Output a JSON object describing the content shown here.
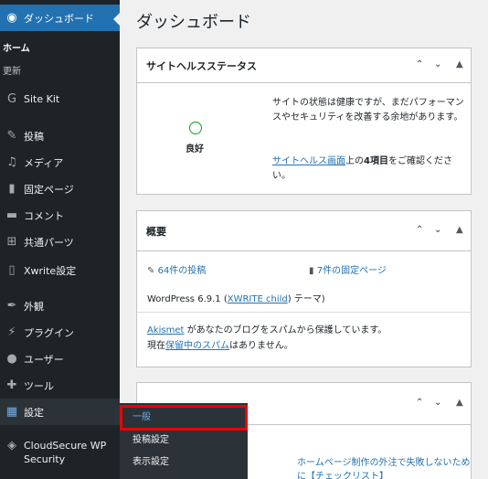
{
  "sidebar": {
    "dashboard_label": "ダッシュボード",
    "sub_home": "ホーム",
    "sub_updates": "更新",
    "items": [
      {
        "label": "Site Kit",
        "icon": "google-g-icon"
      },
      {
        "label": "投稿",
        "icon": "pin-icon"
      },
      {
        "label": "メディア",
        "icon": "media-icon"
      },
      {
        "label": "固定ページ",
        "icon": "page-icon"
      },
      {
        "label": "コメント",
        "icon": "comment-icon"
      },
      {
        "label": "共通パーツ",
        "icon": "grid-icon"
      },
      {
        "label": "Xwrite設定",
        "icon": "book-icon"
      },
      {
        "label": "外観",
        "icon": "brush-icon"
      },
      {
        "label": "プラグイン",
        "icon": "plug-icon"
      },
      {
        "label": "ユーザー",
        "icon": "user-icon"
      },
      {
        "label": "ツール",
        "icon": "wrench-icon"
      },
      {
        "label": "設定",
        "icon": "settings-icon"
      },
      {
        "label": "CloudSecure WP Security",
        "icon": "shield-icon"
      }
    ]
  },
  "flyout": {
    "items": [
      "一般",
      "投稿設定",
      "表示設定"
    ]
  },
  "main": {
    "title": "ダッシュボード",
    "site_health": {
      "title": "サイトヘルスステータス",
      "status": "良好",
      "desc": "サイトの状態は健康ですが、まだパフォーマンスやセキュリティを改善する余地があります。",
      "link_text": "サイトヘルス画面",
      "after_link": "上の",
      "count": "4項目",
      "after_count": "をご確認ください。"
    },
    "glance": {
      "title": "概要",
      "posts": "64件の投稿",
      "pages": "7件の固定ページ",
      "wp_version_text": "WordPress 6.9.1 (",
      "theme_link": "XWRITE child",
      "theme_suffix": ") テーマ)",
      "akismet_link": "Akismet",
      "akismet_text": " があなたのブログをスパムから保護しています。",
      "spam_prefix": "現在",
      "spam_link": "保留中のスパム",
      "spam_suffix": "はありません。"
    },
    "third_box": {
      "link_text": "ホームページ制作の外注で失敗しないために【チェックリスト】"
    }
  }
}
